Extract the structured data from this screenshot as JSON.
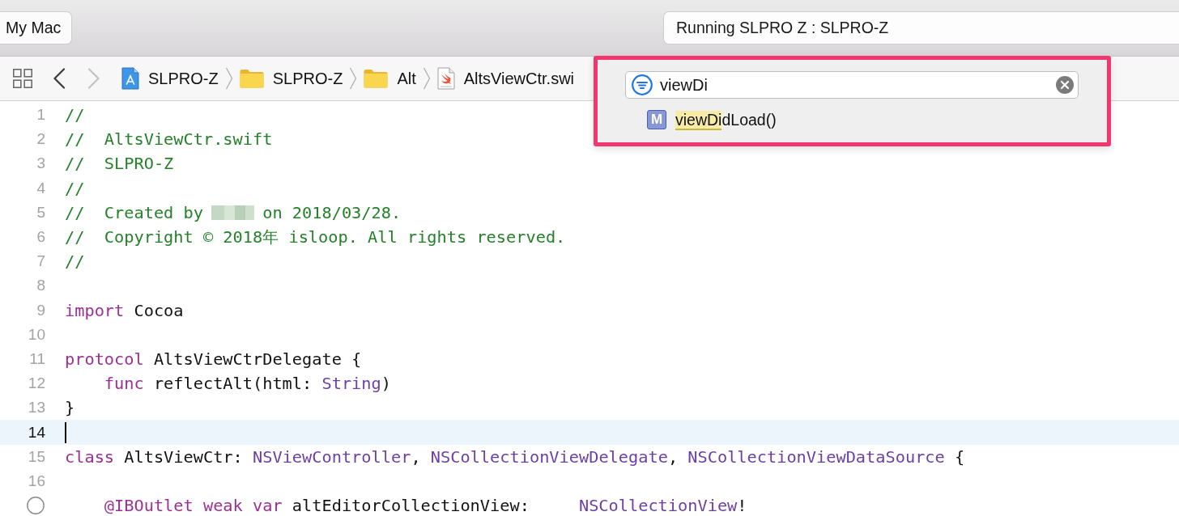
{
  "toolbar": {
    "scheme_button": "My Mac",
    "activity_status": "Running SLPRO Z : SLPRO-Z"
  },
  "jump_bar": {
    "back_enabled": true,
    "forward_enabled": false,
    "path": [
      {
        "kind": "project",
        "label": "SLPRO-Z"
      },
      {
        "kind": "folder",
        "label": "SLPRO-Z"
      },
      {
        "kind": "folder",
        "label": "Alt"
      },
      {
        "kind": "swift-file",
        "label": "AltsViewCtr.swi"
      }
    ]
  },
  "symbol_popup": {
    "search": {
      "value": "viewDi"
    },
    "results": [
      {
        "symbol": "M",
        "label_parts": [
          {
            "text": "viewDi",
            "highlighted": true
          },
          {
            "text": "dLoad()",
            "highlighted": false
          }
        ]
      }
    ]
  },
  "editor": {
    "lines": [
      {
        "number": "1",
        "current": false,
        "indented": false,
        "connection_marker": false,
        "tokens": [
          {
            "kind": "comment",
            "text": "//"
          }
        ]
      },
      {
        "number": "2",
        "current": false,
        "indented": false,
        "connection_marker": false,
        "tokens": [
          {
            "kind": "comment",
            "text": "//  AltsViewCtr.swift"
          }
        ]
      },
      {
        "number": "3",
        "current": false,
        "indented": false,
        "connection_marker": false,
        "tokens": [
          {
            "kind": "comment",
            "text": "//  SLPRO-Z"
          }
        ]
      },
      {
        "number": "4",
        "current": false,
        "indented": false,
        "connection_marker": false,
        "tokens": [
          {
            "kind": "comment",
            "text": "//"
          }
        ]
      },
      {
        "number": "5",
        "current": false,
        "indented": false,
        "connection_marker": false,
        "tokens": [
          {
            "kind": "comment",
            "text": "//  Created by"
          },
          {
            "kind": "redacted"
          },
          {
            "kind": "comment",
            "text": "on 2018/03/28."
          }
        ]
      },
      {
        "number": "6",
        "current": false,
        "indented": false,
        "connection_marker": false,
        "tokens": [
          {
            "kind": "comment",
            "text": "//  Copyright © 2018年 isloop. All rights reserved."
          }
        ]
      },
      {
        "number": "7",
        "current": false,
        "indented": false,
        "connection_marker": false,
        "tokens": [
          {
            "kind": "comment",
            "text": "//"
          }
        ]
      },
      {
        "number": "8",
        "current": false,
        "connection_marker": false
      },
      {
        "number": "9",
        "current": false,
        "indented": false,
        "connection_marker": false,
        "tokens": [
          {
            "kind": "keyword",
            "text": "import"
          },
          {
            "kind": "plain",
            "text": " Cocoa"
          }
        ]
      },
      {
        "number": "10",
        "current": false,
        "connection_marker": false
      },
      {
        "number": "11",
        "current": false,
        "indented": false,
        "connection_marker": false,
        "tokens": [
          {
            "kind": "keyword",
            "text": "protocol"
          },
          {
            "kind": "plain",
            "text": " AltsViewCtrDelegate {"
          }
        ]
      },
      {
        "number": "12",
        "current": false,
        "indented": true,
        "connection_marker": false,
        "tokens": [
          {
            "kind": "keyword",
            "text": "func"
          },
          {
            "kind": "plain",
            "text": " reflectAlt(html: "
          },
          {
            "kind": "type",
            "text": "String"
          },
          {
            "kind": "plain",
            "text": ")"
          }
        ]
      },
      {
        "number": "13",
        "current": false,
        "indented": false,
        "connection_marker": false,
        "tokens": [
          {
            "kind": "plain",
            "text": "}"
          }
        ]
      },
      {
        "number": "14",
        "current": true,
        "indented": false,
        "connection_marker": false
      },
      {
        "number": "15",
        "current": false,
        "indented": false,
        "connection_marker": false,
        "tokens": [
          {
            "kind": "keyword",
            "text": "class"
          },
          {
            "kind": "plain",
            "text": " AltsViewCtr: "
          },
          {
            "kind": "type",
            "text": "NSViewController"
          },
          {
            "kind": "plain",
            "text": ", "
          },
          {
            "kind": "type",
            "text": "NSCollectionViewDelegate"
          },
          {
            "kind": "plain",
            "text": ", "
          },
          {
            "kind": "type",
            "text": "NSCollectionViewDataSource"
          },
          {
            "kind": "plain",
            "text": " {"
          }
        ]
      },
      {
        "number": "16",
        "current": false,
        "connection_marker": false
      },
      {
        "current": false,
        "indented": true,
        "connection_marker": true,
        "tokens": [
          {
            "kind": "keyword",
            "text": "@IBOutlet weak var"
          },
          {
            "kind": "plain",
            "text": " altEditorCollectionView:     "
          },
          {
            "kind": "type",
            "text": "NSCollectionView"
          },
          {
            "kind": "plain",
            "text": "!"
          }
        ]
      }
    ]
  }
}
